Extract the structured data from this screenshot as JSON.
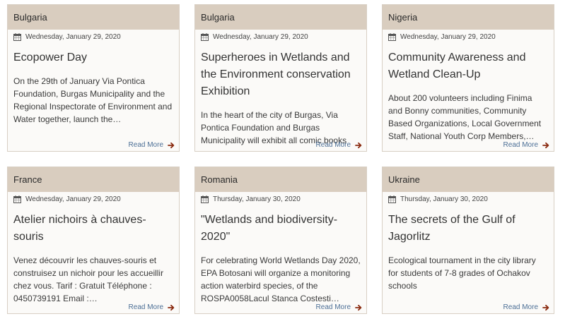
{
  "colors": {
    "header_bg": "#d9cdbf",
    "card_bg": "#fbfaf8",
    "border": "#d8cfc4",
    "link": "#4c6f96",
    "arrow": "#8a2b10"
  },
  "cards": [
    {
      "country": "Bulgaria",
      "date": "Wednesday, January 29, 2020",
      "title": "Ecopower Day",
      "excerpt": "On the 29th of January Via Pontica Foundation, Burgas Municipality and the Regional Inspectorate of Environment and Water together, launch the…",
      "link_label": "Read More"
    },
    {
      "country": "Bulgaria",
      "date": "Wednesday, January 29, 2020",
      "title": "Superheroes in Wetlands and the Environment conservation Exhibition",
      "excerpt": "In the heart of the city of Burgas, Via Pontica Foundation and Burgas Municipality will exhibit all comic books",
      "link_label": "Read More"
    },
    {
      "country": "Nigeria",
      "date": "Wednesday, January 29, 2020",
      "title": "Community Awareness and Wetland Clean-Up",
      "excerpt": "About 200 volunteers including Finima and Bonny communities, Community Based Organizations, Local Government Staff, National Youth Corp Members,…",
      "link_label": "Read More"
    },
    {
      "country": "France",
      "date": "Wednesday, January 29, 2020",
      "title": "Atelier nichoirs à chauves-souris",
      "excerpt": "Venez découvrir les chauves-souris et construisez un nichoir pour les accueillir chez vous. Tarif : Gratuit Téléphone : 0450739191 Email :…",
      "link_label": "Read More"
    },
    {
      "country": "Romania",
      "date": "Thursday, January 30, 2020",
      "title": "\"Wetlands and biodiversity-2020\"",
      "excerpt": "For celebrating World Wetlands Day 2020, EPA Botosani will organize a monitoring action waterbird species, of the ROSPA0058Lacul Stanca Costesti…",
      "link_label": "Read More"
    },
    {
      "country": "Ukraine",
      "date": "Thursday, January 30, 2020",
      "title": "The secrets of the Gulf of Jagorlitz",
      "excerpt": "Ecological tournament in the city library for students of 7-8 grades of Ochakov schools",
      "link_label": "Read More"
    }
  ]
}
